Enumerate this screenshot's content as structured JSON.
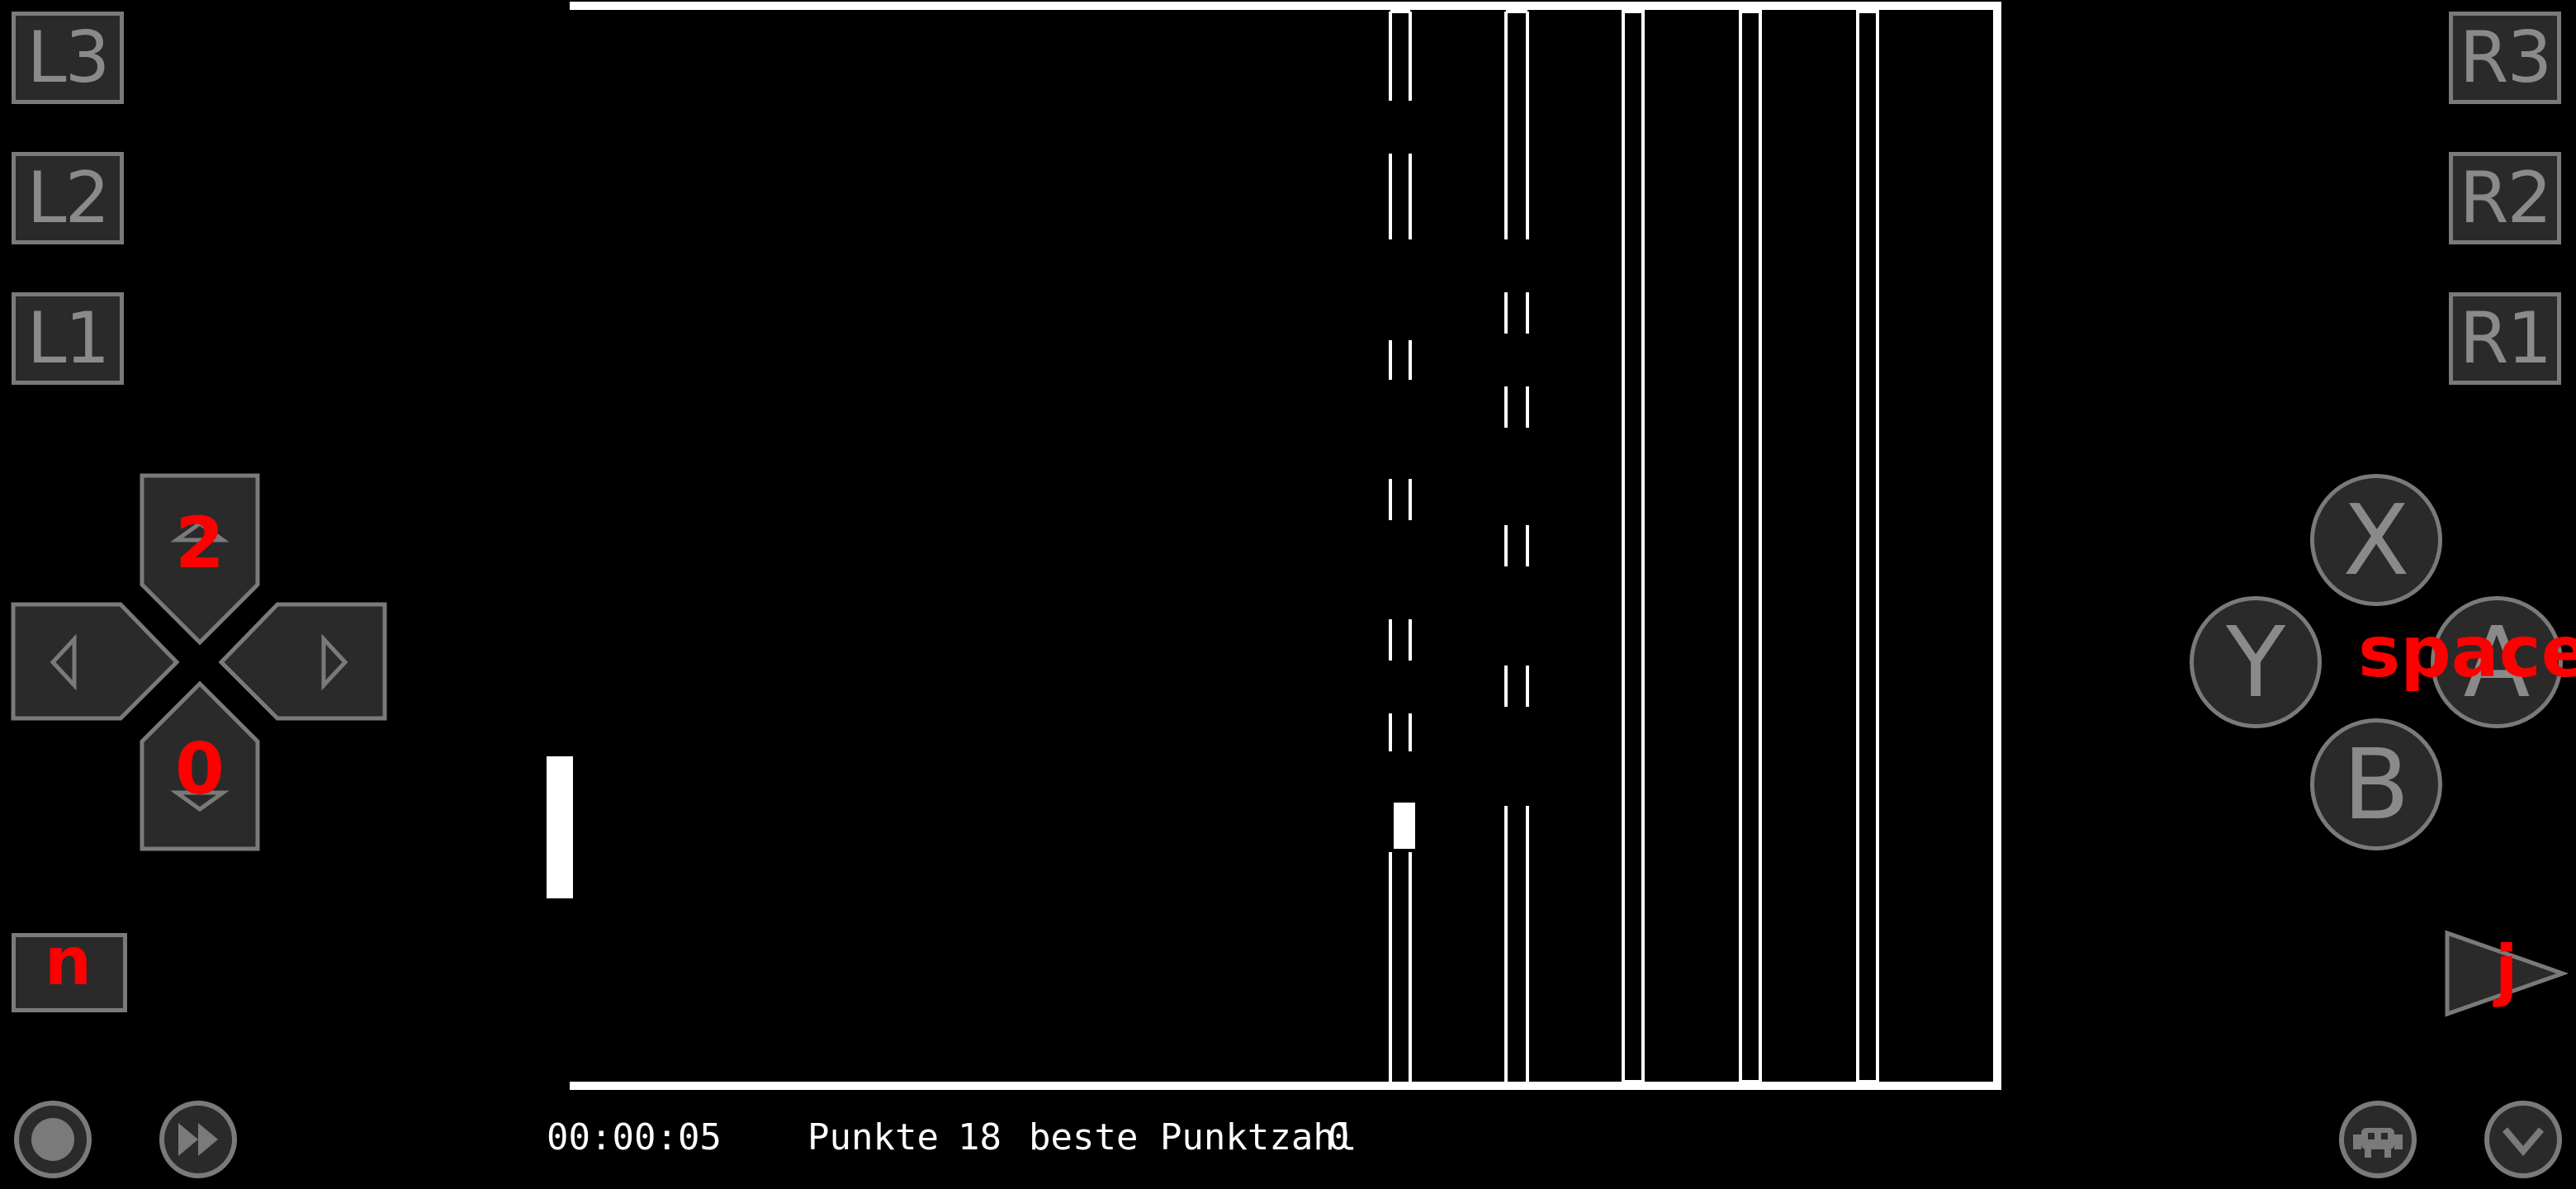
{
  "game": {
    "timer": "00:00:05",
    "score_label": "Punkte",
    "score_value": "18",
    "best_label": "beste Punktzahl",
    "best_value": "0"
  },
  "controls": {
    "left_shoulder": [
      "L3",
      "L2",
      "L1"
    ],
    "right_shoulder": [
      "R3",
      "R2",
      "R1"
    ],
    "face": {
      "x": "X",
      "y": "Y",
      "a": "A",
      "b": "B"
    },
    "dpad_up_key": "2",
    "dpad_down_key": "0",
    "select_key": "n",
    "start_key": "j",
    "a_key": "space"
  },
  "colors": {
    "overlay_key": "#ff0000",
    "button_fill": "#2a2a2a",
    "button_border": "#7a7a7a",
    "game_fg": "#ffffff"
  },
  "icons": [
    "up-arrow-icon",
    "down-arrow-icon",
    "left-arrow-icon",
    "right-arrow-icon",
    "record-icon",
    "fast-forward-icon",
    "retroarch-menu-icon",
    "chevron-down-icon"
  ]
}
